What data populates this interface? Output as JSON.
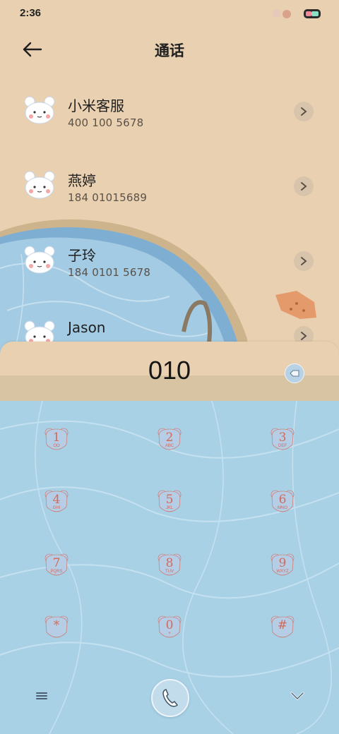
{
  "status_bar": {
    "time": "2:36"
  },
  "header": {
    "title": "通话",
    "back_icon": "arrow-left-icon"
  },
  "contacts": [
    {
      "name": "小米客服",
      "number": "400 100 5678"
    },
    {
      "name": "燕婷",
      "number": "184 01015689"
    },
    {
      "name": "子玲",
      "number": "184 0101 5678"
    },
    {
      "name": "Jason",
      "number": ""
    }
  ],
  "dialer": {
    "input_value": "010",
    "keys": [
      {
        "digit": "1",
        "letters": "OO"
      },
      {
        "digit": "2",
        "letters": "ABC"
      },
      {
        "digit": "3",
        "letters": "DEF"
      },
      {
        "digit": "4",
        "letters": "GHI"
      },
      {
        "digit": "5",
        "letters": "JKL"
      },
      {
        "digit": "6",
        "letters": "MNO"
      },
      {
        "digit": "7",
        "letters": "PQRS"
      },
      {
        "digit": "8",
        "letters": "TUV"
      },
      {
        "digit": "9",
        "letters": "WXYZ"
      },
      {
        "digit": "*",
        "letters": ""
      },
      {
        "digit": "0",
        "letters": "+"
      },
      {
        "digit": "#",
        "letters": ""
      }
    ]
  },
  "colors": {
    "sand": "#e9d0b0",
    "water": "#a9d1e6",
    "key_face": "#b6cde6",
    "key_text": "#d26a5a"
  }
}
